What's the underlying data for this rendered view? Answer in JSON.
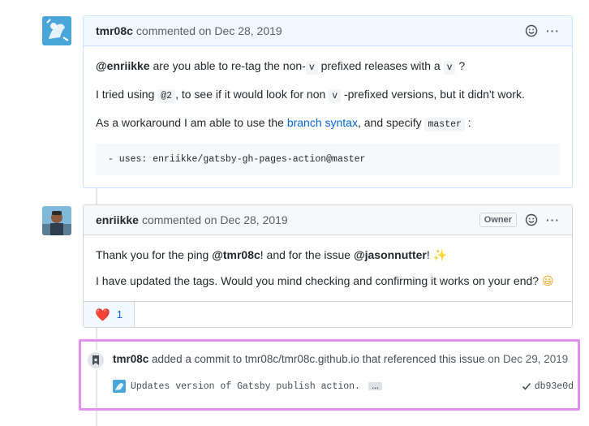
{
  "comment1": {
    "author": "tmr08c",
    "meta": "commented on Dec 28, 2019",
    "p1_mention": "@enriikke",
    "p1_a": " are you able to re-tag the non-",
    "p1_code1": "v",
    "p1_b": " prefixed releases with a ",
    "p1_code2": "v",
    "p1_c": " ?",
    "p2_a": "I tried using ",
    "p2_code": "@2",
    "p2_b": ", to see if it would look for non ",
    "p2_code2": "v",
    "p2_c": " -prefixed versions, but it didn't work.",
    "p3_a": "As a workaround I am able to use the ",
    "p3_link": "branch syntax",
    "p3_b": ", and specify ",
    "p3_code": "master",
    "p3_c": " :",
    "code_block": "- uses: enriikke/gatsby-gh-pages-action@master",
    "more_label": "···"
  },
  "comment2": {
    "author": "enriikke",
    "meta": "commented on Dec 28, 2019",
    "badge": "Owner",
    "p1_a": "Thank you for the ping ",
    "p1_mention1": "@tmr08c",
    "p1_b": "! and for the issue ",
    "p1_mention2": "@jasonnutter",
    "p1_c": "! ",
    "p1_emoji": "✨",
    "p2": "I have updated the tags. Would you mind checking and confirming it works on your end? ",
    "p2_emoji": "😃",
    "reaction_emoji": "❤️",
    "reaction_count": "1",
    "more_label": "···"
  },
  "event": {
    "author": "tmr08c",
    "text": " added a commit to tmr08c/tmr08c.github.io that referenced this issue",
    "date": " on Dec 29, 2019",
    "commit_message": "Updates version of Gatsby publish action.",
    "ellipsis": "…",
    "sha": "db93e0d"
  },
  "icons": [
    "smiley-icon",
    "kebab-menu-icon",
    "bookmark-icon",
    "check-icon"
  ],
  "colors": {
    "highlight_border": "#e48ff2",
    "link": "#0366d6",
    "header_bg_blue": "#f1f8ff",
    "header_bg_grey": "#f6f8fa"
  }
}
